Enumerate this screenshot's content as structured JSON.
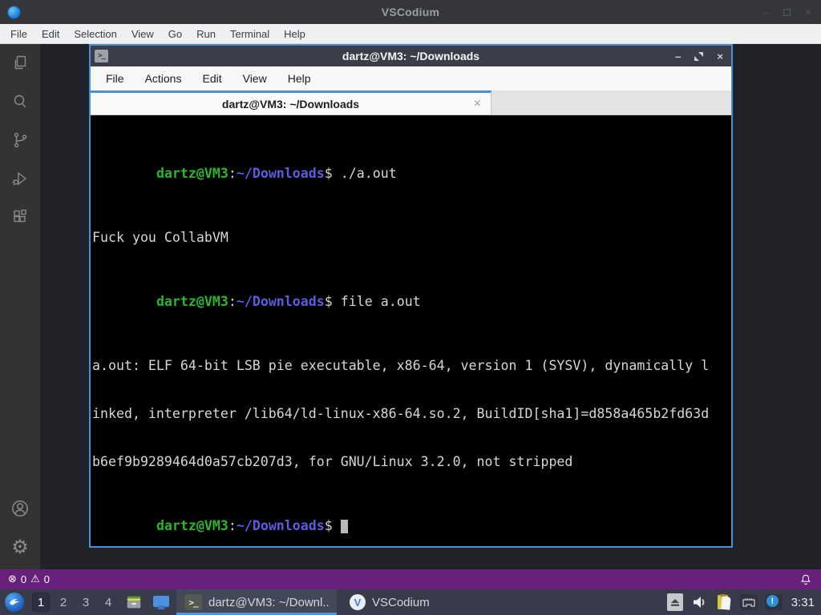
{
  "colors": {
    "accent_blue": "#4a90d9",
    "status_bar_purple": "#68217a",
    "terminal_prompt_green": "#2eb52e",
    "terminal_prompt_blue": "#5c5ce0",
    "taskbar_bg": "#383c4a"
  },
  "vscodium": {
    "window_title": "VSCodium",
    "titlebar_controls": {
      "minimize": "–",
      "close": "×"
    },
    "menu": [
      "File",
      "Edit",
      "Selection",
      "View",
      "Go",
      "Run",
      "Terminal",
      "Help"
    ],
    "status": {
      "error_icon": "⊗",
      "error_count": "0",
      "warning_icon": "⚠",
      "warning_count": "0"
    }
  },
  "terminal_window": {
    "title": "dartz@VM3: ~/Downloads",
    "app_icon_glyph": ">_",
    "controls": {
      "minimize": "–",
      "close": "×"
    },
    "menu": [
      "File",
      "Actions",
      "Edit",
      "View",
      "Help"
    ],
    "tab_label": "dartz@VM3: ~/Downloads",
    "tab_close": "×",
    "shell": {
      "prompt_user": "dartz@VM3",
      "prompt_sep": ":",
      "prompt_path": "~/Downloads",
      "prompt_symbol": "$",
      "command_1": "./a.out",
      "output_1": "Fuck you CollabVM",
      "command_2": "file a.out",
      "file_out_1": "a.out: ELF 64-bit LSB pie executable, x86-64, version 1 (SYSV), dynamically l",
      "file_out_2": "inked, interpreter /lib64/ld-linux-x86-64.so.2, BuildID[sha1]=d858a465b2fd63d",
      "file_out_3": "b6ef9b9289464d0a57cb207d3, for GNU/Linux 3.2.0, not stripped"
    }
  },
  "taskbar": {
    "workspaces": [
      "1",
      "2",
      "3",
      "4"
    ],
    "terminal_icon_glyph": ">_",
    "terminal_button_label": "dartz@VM3: ~/Downl...",
    "vscodium_icon_glyph": "V",
    "vscodium_button_label": "VSCodium",
    "notifier_glyph": "!",
    "clock": "3:31"
  }
}
